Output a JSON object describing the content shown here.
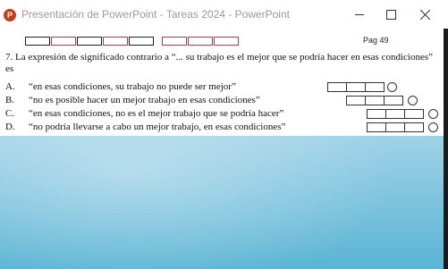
{
  "window": {
    "app_icon": "P",
    "title": "Presentación de PowerPoint  -  Tareas 2024 - PowerPoint"
  },
  "slide": {
    "page": "Pag 49",
    "question": {
      "number": "7.",
      "text": "La expresión de significado contrario a “... su trabajo es el mejor que se podría hacer en esas condiciones” es"
    },
    "options": [
      {
        "letter": "A.",
        "text": "“en esas condiciones, su trabajo no puede ser mejor”"
      },
      {
        "letter": "B.",
        "text": "“no es posible hacer un mejor trabajo en esas condiciones”"
      },
      {
        "letter": "C.",
        "text": "“en esas condiciones, no es el mejor trabajo que se podría hacer”"
      },
      {
        "letter": "D.",
        "text": "“no podría llevarse a cabo un mejor trabajo, en esas condiciones”"
      }
    ]
  },
  "colors": {
    "accent_red": "#c0394a",
    "powerpoint": "#c43e1c"
  }
}
